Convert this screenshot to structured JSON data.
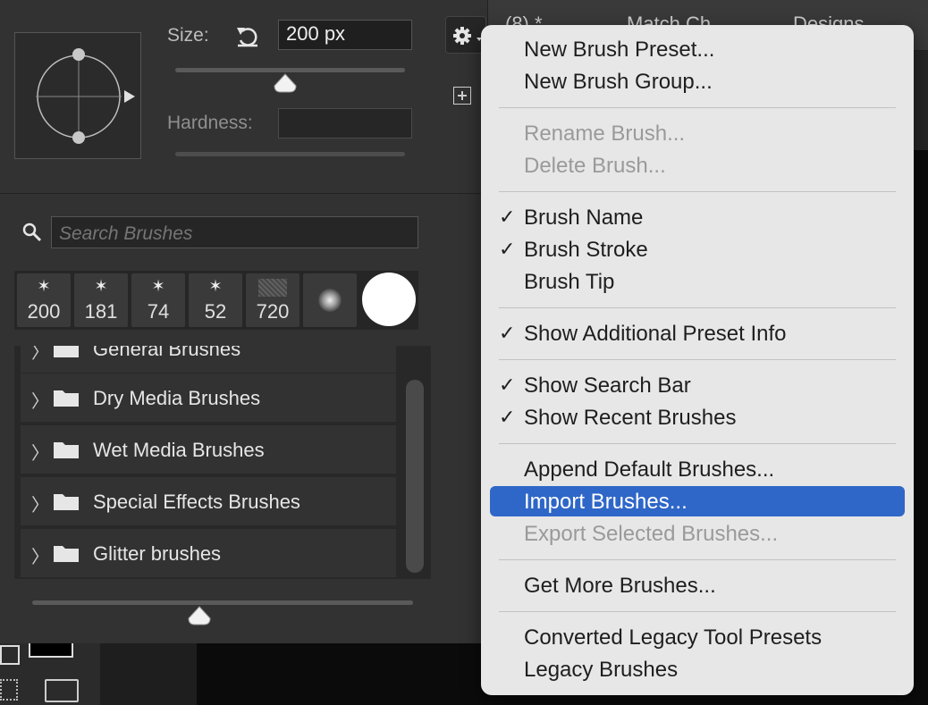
{
  "document_tabs": [
    {
      "label": "(8) *"
    },
    {
      "label": "Match Ch"
    },
    {
      "label": "Designs"
    }
  ],
  "brush_settings": {
    "size_label": "Size:",
    "size_value": "200 px",
    "size_slider_value": 0.48,
    "hardness_label": "Hardness:",
    "hardness_value": ""
  },
  "search": {
    "placeholder": "Search Brushes"
  },
  "recent_brushes": [
    {
      "size": "200",
      "kind": "star"
    },
    {
      "size": "181",
      "kind": "star"
    },
    {
      "size": "74",
      "kind": "star"
    },
    {
      "size": "52",
      "kind": "star"
    },
    {
      "size": "720",
      "kind": "texture"
    },
    {
      "size": "",
      "kind": "soft-round"
    },
    {
      "size": "",
      "kind": "hard-round"
    }
  ],
  "brush_groups": [
    {
      "label": "General Brushes"
    },
    {
      "label": "Dry Media Brushes"
    },
    {
      "label": "Wet Media Brushes"
    },
    {
      "label": "Special Effects Brushes"
    },
    {
      "label": "Glitter brushes"
    }
  ],
  "preview_size_slider_value": 0.44,
  "menu": {
    "items": [
      {
        "label": "New Brush Preset...",
        "checked": false,
        "disabled": false
      },
      {
        "label": "New Brush Group...",
        "checked": false,
        "disabled": false
      },
      {
        "label": "Rename Brush...",
        "checked": false,
        "disabled": true
      },
      {
        "label": "Delete Brush...",
        "checked": false,
        "disabled": true
      },
      {
        "label": "Brush Name",
        "checked": true,
        "disabled": false
      },
      {
        "label": "Brush Stroke",
        "checked": true,
        "disabled": false
      },
      {
        "label": "Brush Tip",
        "checked": false,
        "disabled": false
      },
      {
        "label": "Show Additional Preset Info",
        "checked": true,
        "disabled": false
      },
      {
        "label": "Show Search Bar",
        "checked": true,
        "disabled": false
      },
      {
        "label": "Show Recent Brushes",
        "checked": true,
        "disabled": false
      },
      {
        "label": "Append Default Brushes...",
        "checked": false,
        "disabled": false
      },
      {
        "label": "Import Brushes...",
        "checked": false,
        "disabled": false,
        "selected": true
      },
      {
        "label": "Export Selected Brushes...",
        "checked": false,
        "disabled": true
      },
      {
        "label": "Get More Brushes...",
        "checked": false,
        "disabled": false
      },
      {
        "label": "Converted Legacy Tool Presets",
        "checked": false,
        "disabled": false
      },
      {
        "label": "Legacy Brushes",
        "checked": false,
        "disabled": false
      }
    ],
    "check_glyph": "✓",
    "highlight_color": "#2f67c8"
  },
  "icons": {
    "gear": "gear-icon",
    "reset": "reset-size-icon",
    "new_preset": "new-preset-icon",
    "search": "search-icon",
    "folder": "folder-icon",
    "chevron": "chevron-right-icon"
  }
}
